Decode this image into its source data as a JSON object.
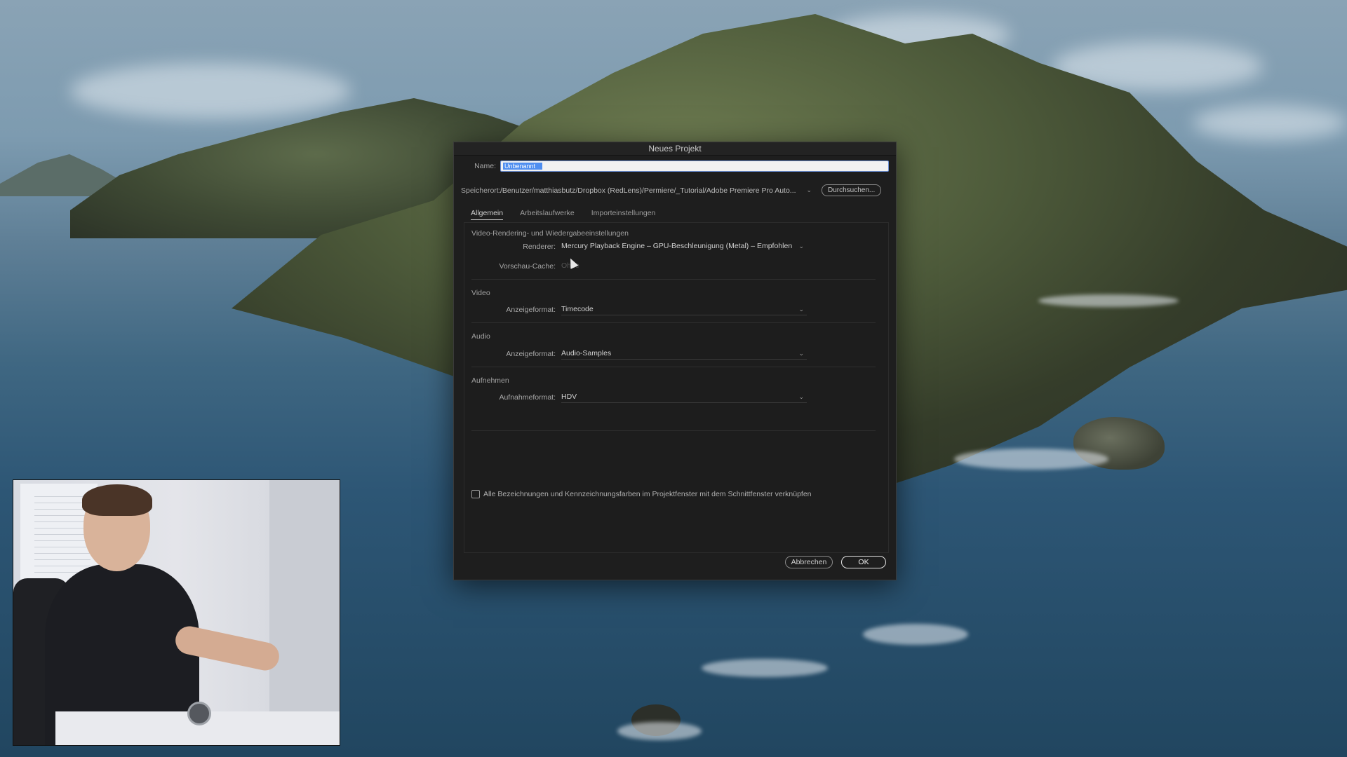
{
  "dialog": {
    "title": "Neues Projekt",
    "name_label": "Name:",
    "name_value": "Unbenannt",
    "location_label": "Speicherort:",
    "location_path": "/Benutzer/matthiasbutz/Dropbox (RedLens)/Permiere/_Tutorial/Adobe Premiere Pro Auto...",
    "browse_label": "Durchsuchen...",
    "tabs": [
      {
        "label": "Allgemein",
        "active": true
      },
      {
        "label": "Arbeitslaufwerke",
        "active": false
      },
      {
        "label": "Importeinstellungen",
        "active": false
      }
    ],
    "sections": {
      "rendering": {
        "title": "Video-Rendering- und Wiedergabeeinstellungen",
        "renderer_label": "Renderer:",
        "renderer_value": "Mercury Playback Engine – GPU-Beschleunigung (Metal) – Empfohlen",
        "preview_cache_label": "Vorschau-Cache:",
        "preview_cache_value": "Ohne"
      },
      "video": {
        "title": "Video",
        "display_format_label": "Anzeigeformat:",
        "display_format_value": "Timecode"
      },
      "audio": {
        "title": "Audio",
        "display_format_label": "Anzeigeformat:",
        "display_format_value": "Audio-Samples"
      },
      "capture": {
        "title": "Aufnehmen",
        "capture_format_label": "Aufnahmeformat:",
        "capture_format_value": "HDV"
      }
    },
    "checkbox_label": "Alle Bezeichnungen und Kennzeichnungsfarben im Projektfenster mit dem Schnittfenster verknüpfen",
    "checkbox_checked": false,
    "cancel_label": "Abbrechen",
    "ok_label": "OK"
  },
  "icons": {
    "dropdown": "chevron-down-icon",
    "cursor": "pointer-cursor-icon"
  },
  "colors": {
    "dialog_bg": "#1e1e1e",
    "selection": "#4f8ef0",
    "text": "#b8b8b8"
  }
}
